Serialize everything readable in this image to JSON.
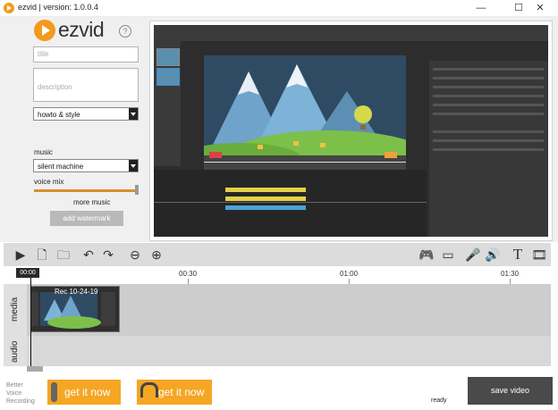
{
  "window": {
    "title": "ezvid | version: 1.0.0.4",
    "min_glyph": "—",
    "max_glyph": "☐",
    "close_glyph": "✕"
  },
  "logo": {
    "text": "ezvid",
    "help_glyph": "?"
  },
  "form": {
    "title_placeholder": "title",
    "description_placeholder": "description",
    "category_value": "howto & style",
    "music_label": "music",
    "music_value": "silent machine",
    "voice_mix_label": "voice mix",
    "voice_mix_level": 1.0,
    "more_music": "more music",
    "add_watermark": "add watermark"
  },
  "toolbar": {
    "icons": [
      "play-icon",
      "add-file-icon",
      "open-folder-icon",
      "undo-icon",
      "redo-icon",
      "zoom-out-icon",
      "zoom-in-icon",
      "gamepad-icon",
      "screen-capture-icon",
      "microphone-icon",
      "speech-icon",
      "text-icon",
      "film-icon"
    ]
  },
  "timeline": {
    "playhead_time": "00:00",
    "ticks": [
      "00:30",
      "01:00",
      "01:30"
    ],
    "lanes": [
      "media",
      "audio"
    ],
    "clip_label": "Rec 10-24-19"
  },
  "bottom": {
    "voice_label_1": "Better",
    "voice_label_2": "Voice",
    "voice_label_3": "Recording",
    "get_it_now_1": "get it now",
    "get_it_now_2": "get it now",
    "status": "ready",
    "save_video": "save video"
  },
  "colors": {
    "accent": "#f39a1e",
    "button_orange": "#f5a623",
    "dark_button": "#4a4a4a"
  }
}
